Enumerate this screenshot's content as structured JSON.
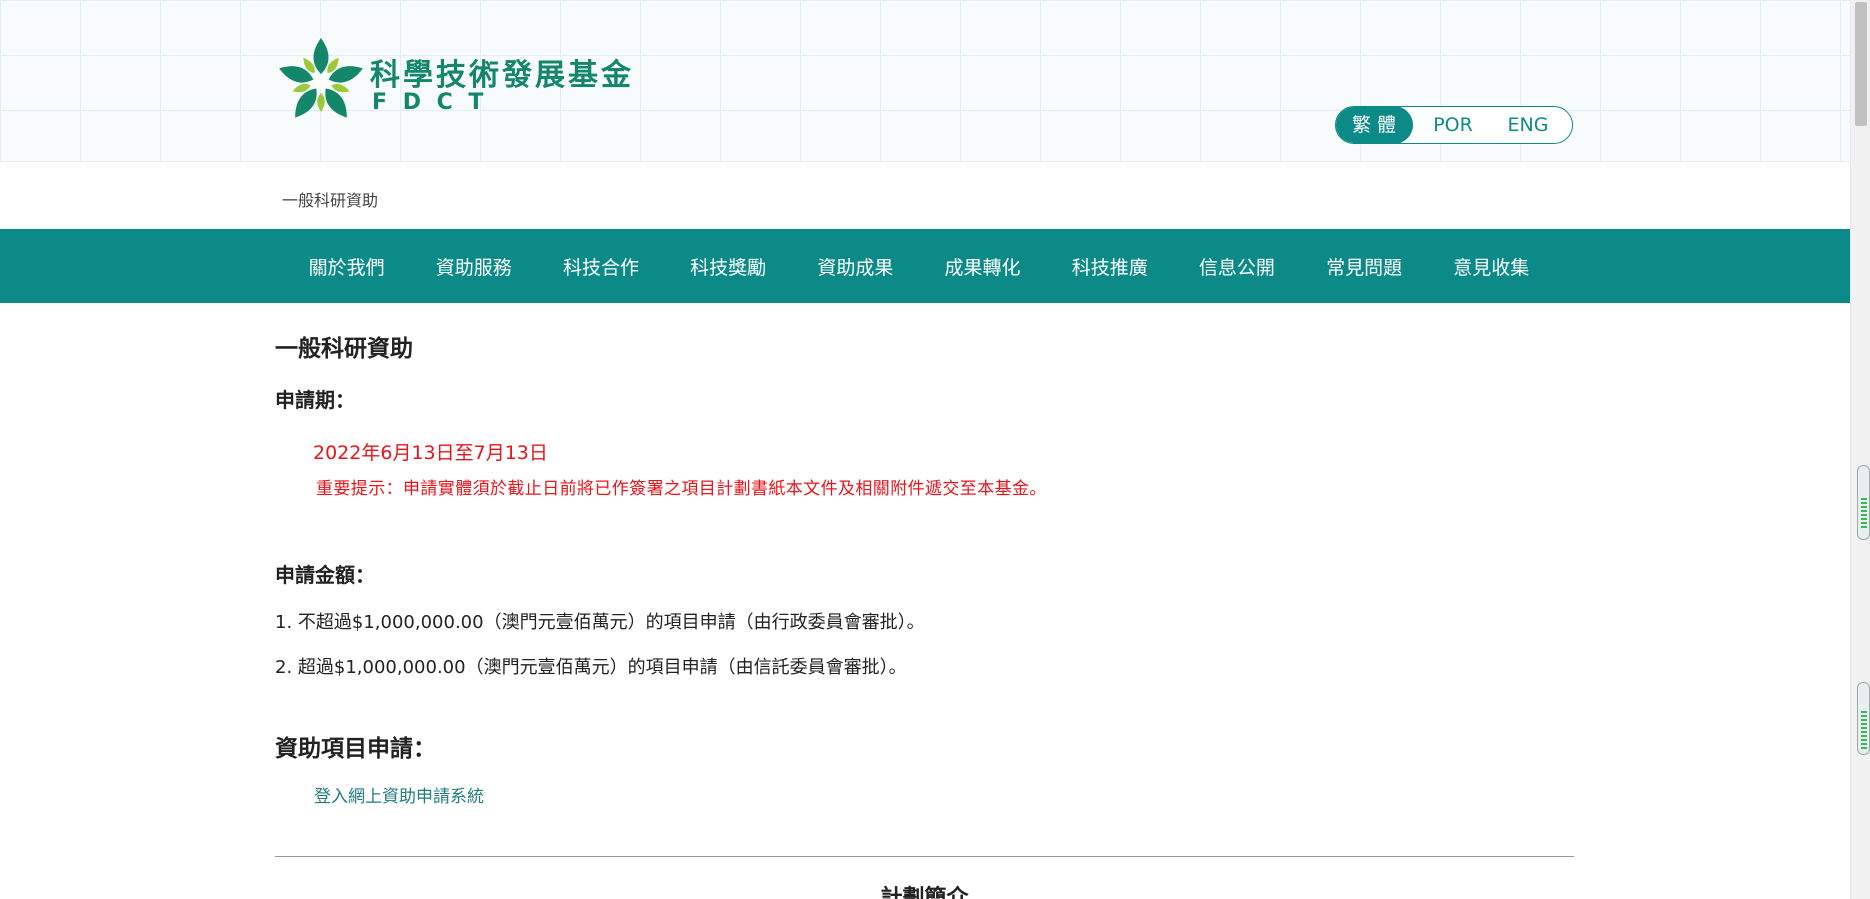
{
  "header": {
    "logo_cn": "科學技術發展基金",
    "logo_en": "F D C T",
    "languages": [
      {
        "label": "繁 體",
        "active": true
      },
      {
        "label": "POR",
        "active": false
      },
      {
        "label": "ENG",
        "active": false
      }
    ]
  },
  "breadcrumb": "一般科研資助",
  "nav": {
    "items": [
      "關於我們",
      "資助服務",
      "科技合作",
      "科技獎勵",
      "資助成果",
      "成果轉化",
      "科技推廣",
      "信息公開",
      "常見問題",
      "意見收集"
    ]
  },
  "content": {
    "title": "一般科研資助",
    "period_label": "申請期：",
    "period_date": "2022年6月13日至7月13日",
    "period_note": "重要提示：申請實體須於截止日前將已作簽署之項目計劃書紙本文件及相關附件遞交至本基金。",
    "amount_label": "申請金額：",
    "amount_lines": [
      "1. 不超過$1,000,000.00（澳門元壹佰萬元）的項目申請（由行政委員會審批）。",
      "2. 超過$1,000,000.00（澳門元壹佰萬元）的項目申請（由信託委員會審批）。"
    ],
    "application_title": "資助項目申請：",
    "application_link": "登入網上資助申請系統",
    "intro_title": "計劃簡介"
  },
  "colors": {
    "brand": "#0c8a88",
    "logo_green": "#14876b",
    "alert_red": "#e8141b"
  },
  "icons": {
    "logo": "fdct-star-logo-icon"
  }
}
